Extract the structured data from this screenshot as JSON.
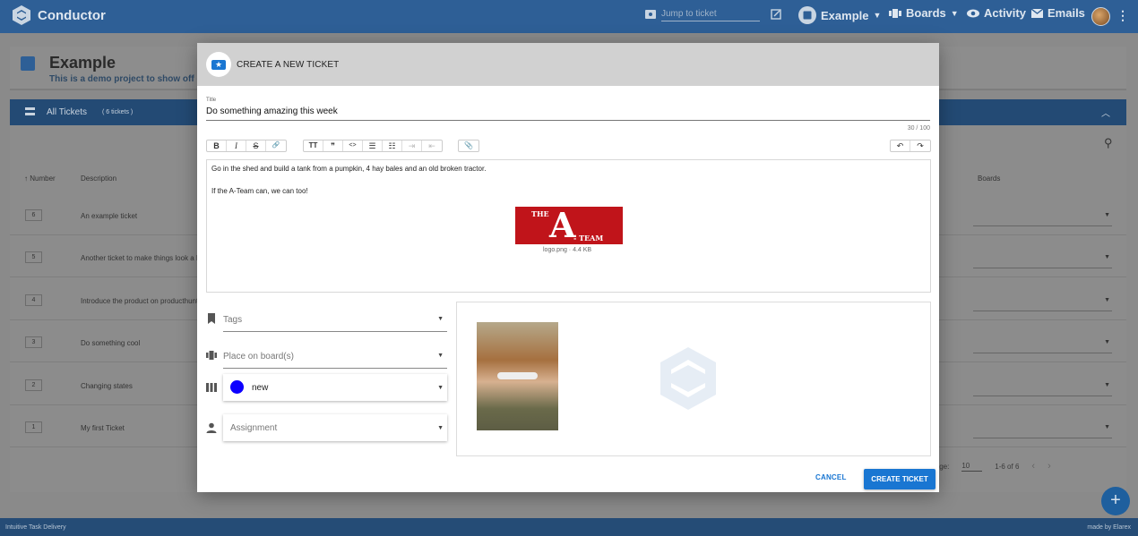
{
  "appbar": {
    "brand": "Conductor",
    "jump_placeholder": "Jump to ticket",
    "board_menu": "Example",
    "boards": "Boards",
    "activity": "Activity",
    "emails": "Emails",
    "kebab": "⋮"
  },
  "page": {
    "title": "Example",
    "subtitle": "This is a demo project to show off co",
    "table_title": "All Tickets",
    "ticket_count": "( 6 tickets )",
    "col_number": "↑ Number",
    "col_description": "Description",
    "col_boards": "Boards",
    "rows": [
      {
        "num": "6",
        "desc": "An example ticket"
      },
      {
        "num": "5",
        "desc": "Another ticket to make things look a b"
      },
      {
        "num": "4",
        "desc": "Introduce the product on producthunt"
      },
      {
        "num": "3",
        "desc": "Do something cool"
      },
      {
        "num": "2",
        "desc": "Changing states"
      },
      {
        "num": "1",
        "desc": "My first Ticket"
      }
    ],
    "per_page_label": "er page:",
    "per_page": "10",
    "range": "1-6 of 6"
  },
  "dialog": {
    "title": "CREATE A NEW TICKET",
    "title_label": "Title",
    "title_value": "Do something amazing this week",
    "title_counter": "30 / 100",
    "body_line1": "Go in the shed and build a tank from a pumpkin, 4 hay bales and an old broken tractor.",
    "body_line2": "If the A-Team can, we can too!",
    "logo_the": "THE",
    "logo_a": "A",
    "logo_team": "- TEAM",
    "image_caption": "logo.png · 4.4 KB",
    "tags_placeholder": "Tags",
    "boards_placeholder": "Place on board(s)",
    "state_value": "new",
    "state_color": "#0d00ff",
    "assignment_placeholder": "Assignment",
    "cancel": "CANCEL",
    "create": "CREATE TICKET"
  },
  "toolbar": {
    "bold": "B",
    "italic": "I",
    "strike": "S",
    "link": "🔗",
    "heading": "TT",
    "quote": "❞",
    "code": "<>",
    "bullet_list": "☰",
    "ordered_list": "☷",
    "indent": "⇥",
    "outdent": "⇤",
    "attach": "📎",
    "undo": "↶",
    "redo": "↷"
  },
  "footer": {
    "left": "Intuitive Task Delivery",
    "right": "made by Elarex"
  },
  "colors": {
    "appbar": "#2e5f96",
    "primary": "#1976d2"
  }
}
